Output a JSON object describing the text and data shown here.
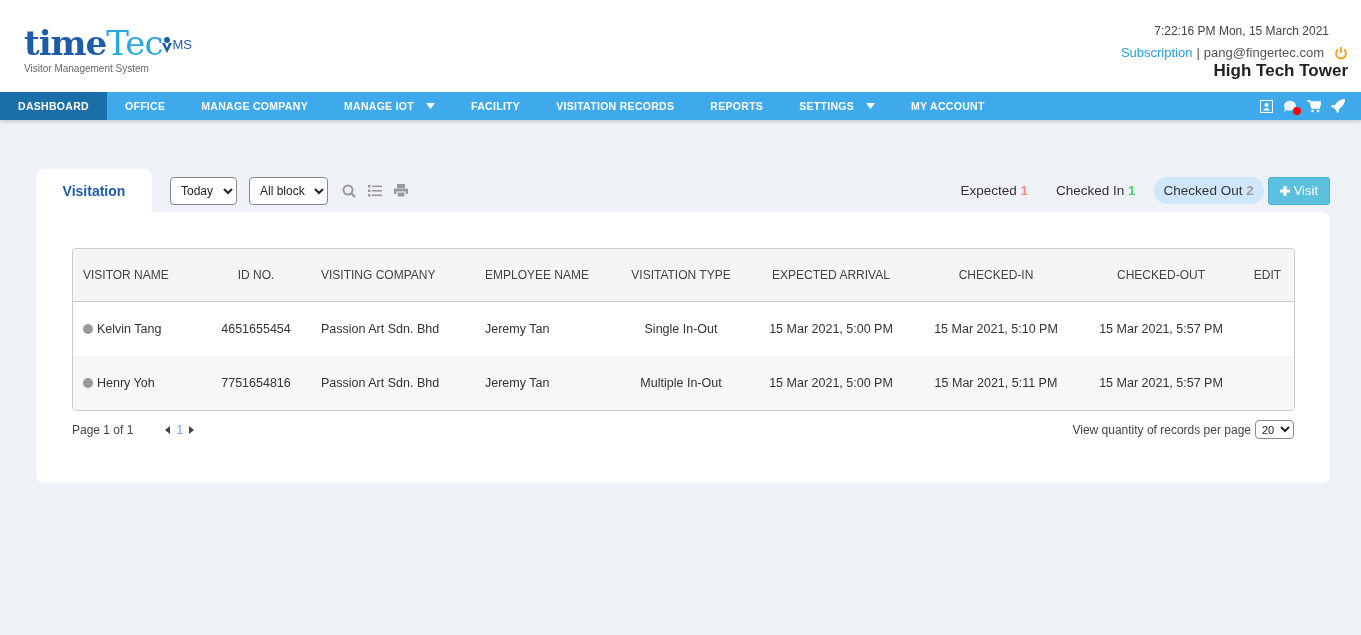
{
  "header": {
    "logo": {
      "word_dark": "time",
      "word_light": "Tec",
      "badge": "MS",
      "tagline": "Visitor Management System"
    },
    "datetime": "7:22:16 PM Mon, 15 March 2021",
    "subscription_link": "Subscription",
    "separator": "|",
    "user_email": "pang@fingertec.com",
    "building": "High Tech Tower"
  },
  "nav": {
    "items": [
      {
        "label": "DASHBOARD",
        "selected": true,
        "dropdown": false
      },
      {
        "label": "OFFICE",
        "selected": false,
        "dropdown": false
      },
      {
        "label": "MANAGE COMPANY",
        "selected": false,
        "dropdown": false
      },
      {
        "label": "MANAGE IOT",
        "selected": false,
        "dropdown": true
      },
      {
        "label": "FACILITY",
        "selected": false,
        "dropdown": false
      },
      {
        "label": "VISITATION RECORDS",
        "selected": false,
        "dropdown": false
      },
      {
        "label": "REPORTS",
        "selected": false,
        "dropdown": false
      },
      {
        "label": "SETTINGS",
        "selected": false,
        "dropdown": true
      },
      {
        "label": "MY ACCOUNT",
        "selected": false,
        "dropdown": false
      }
    ],
    "notification_unread": true
  },
  "toolbar": {
    "tab": "Visitation",
    "date_filter": "Today",
    "block_filter": "All block",
    "status_filters": [
      {
        "label": "Expected",
        "count": "1",
        "color": "#f28b82",
        "selected": false
      },
      {
        "label": "Checked In",
        "count": "1",
        "color": "#4cd964",
        "selected": false
      },
      {
        "label": "Checked Out",
        "count": "2",
        "color": "#9e9e9e",
        "selected": true
      }
    ],
    "add_button": "Visit"
  },
  "table": {
    "columns": [
      "VISITOR NAME",
      "ID NO.",
      "VISITING COMPANY",
      "EMPLOYEE NAME",
      "VISITATION TYPE",
      "EXPECTED ARRIVAL",
      "CHECKED-IN",
      "CHECKED-OUT",
      "EDIT"
    ],
    "rows": [
      {
        "color": "#999999",
        "cells": [
          "Kelvin Tang",
          "4651655454",
          "Passion Art Sdn. Bhd",
          "Jeremy Tan",
          "Single In-Out",
          "15 Mar 2021, 5:00 PM",
          "15 Mar 2021, 5:10 PM",
          "15 Mar 2021, 5:57 PM"
        ]
      },
      {
        "color": "#999999",
        "cells": [
          "Henry Yoh",
          "7751654816",
          "Passion Art Sdn. Bhd",
          "Jeremy Tan",
          "Multiple In-Out",
          "15 Mar 2021, 5:00 PM",
          "15 Mar 2021, 5:11 PM",
          "15 Mar 2021, 5:57 PM"
        ]
      }
    ]
  },
  "pagination": {
    "page_info": "Page 1 of 1",
    "pages": [
      {
        "label": "1",
        "selected": true
      }
    ],
    "per_page_label": "View quantity of records per page",
    "per_page": "20"
  }
}
